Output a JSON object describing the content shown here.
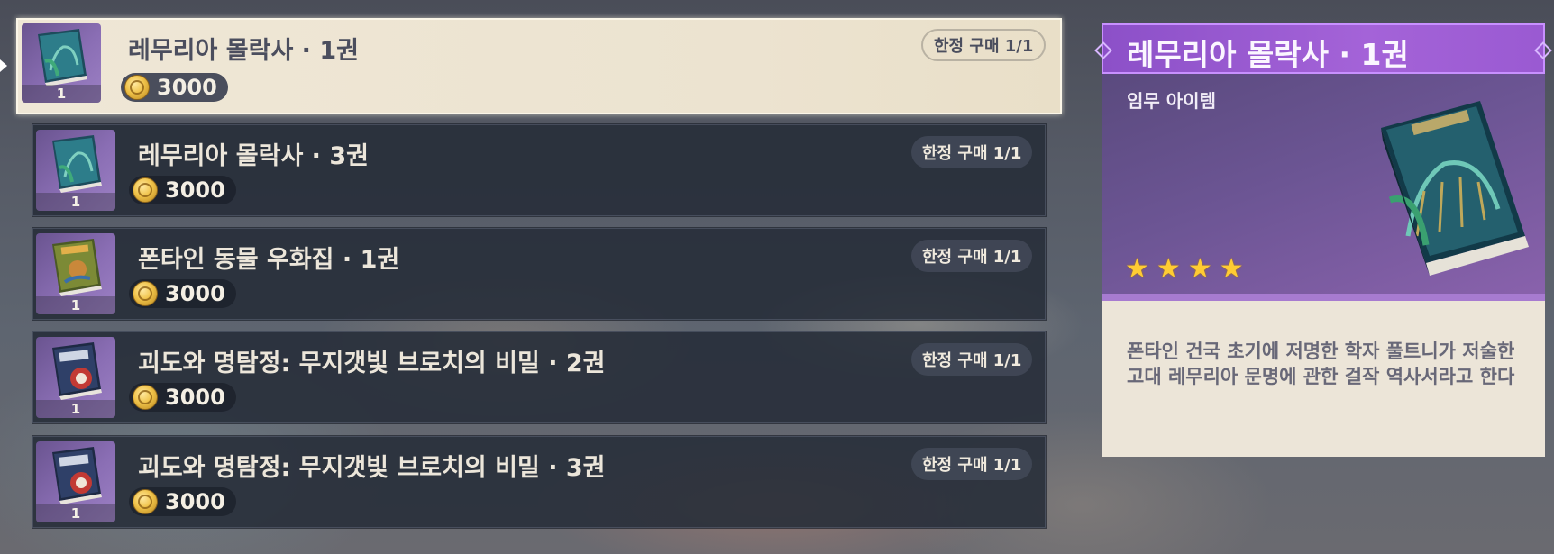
{
  "shop": {
    "items": [
      {
        "name": "레무리아 몰락사 · 1권",
        "qty": "1",
        "price": "3000",
        "limit": "한정 구매 1/1",
        "book": "teal"
      },
      {
        "name": "레무리아 몰락사 · 3권",
        "qty": "1",
        "price": "3000",
        "limit": "한정 구매 1/1",
        "book": "teal"
      },
      {
        "name": "폰타인 동물 우화집 · 1권",
        "qty": "1",
        "price": "3000",
        "limit": "한정 구매 1/1",
        "book": "green"
      },
      {
        "name": "괴도와 명탐정: 무지갯빛 브로치의 비밀 · 2권",
        "qty": "1",
        "price": "3000",
        "limit": "한정 구매 1/1",
        "book": "navy"
      },
      {
        "name": "괴도와 명탐정: 무지갯빛 브로치의 비밀 · 3권",
        "qty": "1",
        "price": "3000",
        "limit": "한정 구매 1/1",
        "book": "navy"
      }
    ],
    "selected_index": 0
  },
  "detail": {
    "title": "레무리아 몰락사 · 1권",
    "type": "임무 아이템",
    "rarity": 4,
    "description": "폰타인 건국 초기에 저명한 학자 풀트니가 저술한 고대 레무리아 문명에 관한 걸작 역사서라고 한다"
  },
  "colors": {
    "title_bar": "#a463d8",
    "star": "#ffcc33",
    "coin": "#f0c34a",
    "selected_row": "#efe7d6"
  },
  "icons": {
    "currency": "mora-coin-icon",
    "star": "star-icon",
    "item": "book-icon"
  }
}
